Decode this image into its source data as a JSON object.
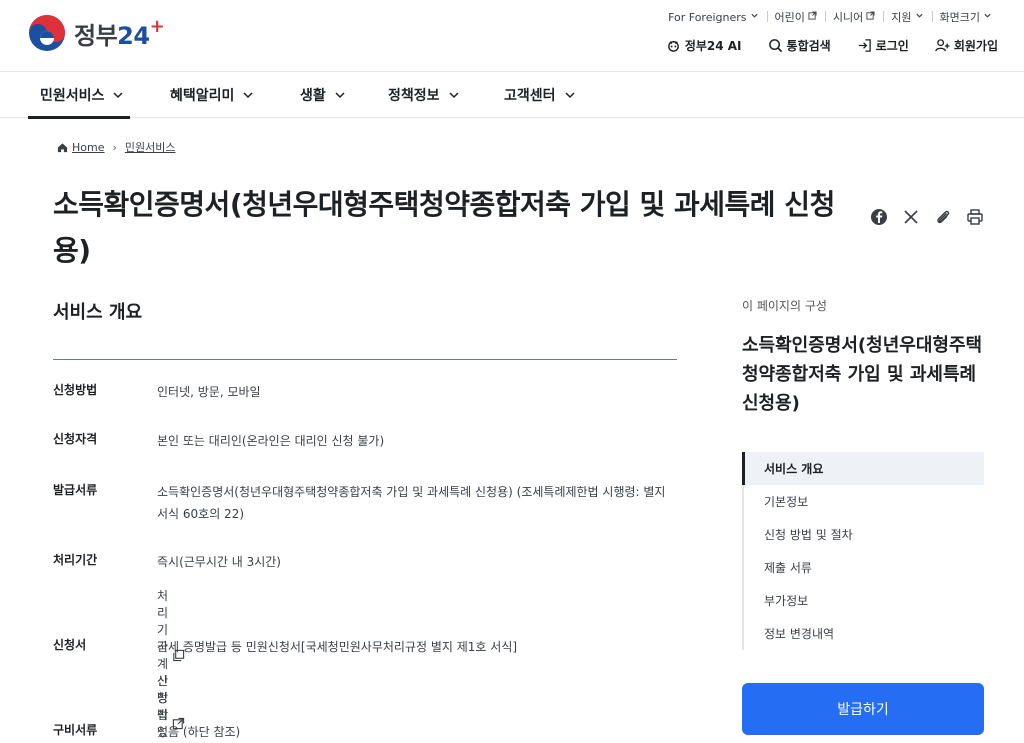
{
  "header": {
    "logo_text": "정부",
    "logo_num": "24",
    "util_links": [
      {
        "label": "For Foreigners",
        "icon": "chevron-down-icon"
      },
      {
        "label": "어린이",
        "icon": "external-link-icon"
      },
      {
        "label": "시니어",
        "icon": "external-link-icon"
      },
      {
        "label": "지원",
        "icon": "chevron-down-icon"
      },
      {
        "label": "화면크기",
        "icon": "chevron-down-icon"
      }
    ],
    "actions": [
      {
        "label": "정부24 AI",
        "icon": "ai-bot-icon"
      },
      {
        "label": "통합검색",
        "icon": "search-icon"
      },
      {
        "label": "로그인",
        "icon": "login-icon"
      },
      {
        "label": "회원가입",
        "icon": "user-plus-icon"
      }
    ]
  },
  "nav": {
    "items": [
      {
        "label": "민원서비스",
        "active": true
      },
      {
        "label": "혜택알리미",
        "active": false
      },
      {
        "label": "생활",
        "active": false
      },
      {
        "label": "정책정보",
        "active": false
      },
      {
        "label": "고객센터",
        "active": false
      }
    ]
  },
  "breadcrumb": {
    "home": "Home",
    "current": "민원서비스"
  },
  "page": {
    "title": "소득확인증명서(청년우대형주택청약종합저축 가입 및 과세특례 신청용)",
    "share_icons": [
      "facebook-icon",
      "x-icon",
      "link-icon",
      "print-icon"
    ]
  },
  "overview": {
    "section_title": "서비스 개요",
    "rows": [
      {
        "label": "신청방법",
        "value": "인터넷, 방문, 모바일"
      },
      {
        "label": "신청자격",
        "value": "본인 또는 대리인(온라인은 대리인 신청 불가)"
      },
      {
        "label": "발급서류",
        "value": "소득확인증명서(청년우대형주택청약종합저축 가입 및 과세특례 신청용) (조세특례제한법 시행령: 별지 서식 60호의 22)"
      },
      {
        "label": "처리기간",
        "value": "즉시(근무시간 내 3시간)",
        "sub": "처리기간 계산 방법"
      },
      {
        "label": "신청서",
        "value": "국세 증명발급 등 민원신청서[국세청민원사무처리규정 별지 제1호 서식]",
        "sub": "신청작성예시"
      },
      {
        "label": "구비서류",
        "value": "있음 (하단 참조)"
      }
    ]
  },
  "toc": {
    "caption": "이 페이지의 구성",
    "title": "소득확인증명서(청년우대형주택청약종합저축 가입 및 과세특례 신청용)",
    "items": [
      {
        "label": "서비스 개요",
        "active": true
      },
      {
        "label": "기본정보",
        "active": false
      },
      {
        "label": "신청 방법 및 절차",
        "active": false
      },
      {
        "label": "제출 서류",
        "active": false
      },
      {
        "label": "부가정보",
        "active": false
      },
      {
        "label": "정보 변경내역",
        "active": false
      }
    ],
    "button_label": "발급하기"
  },
  "colors": {
    "primary_button": "#256ef4",
    "logo_red": "#e0303a",
    "logo_blue": "#1d4fa0"
  }
}
